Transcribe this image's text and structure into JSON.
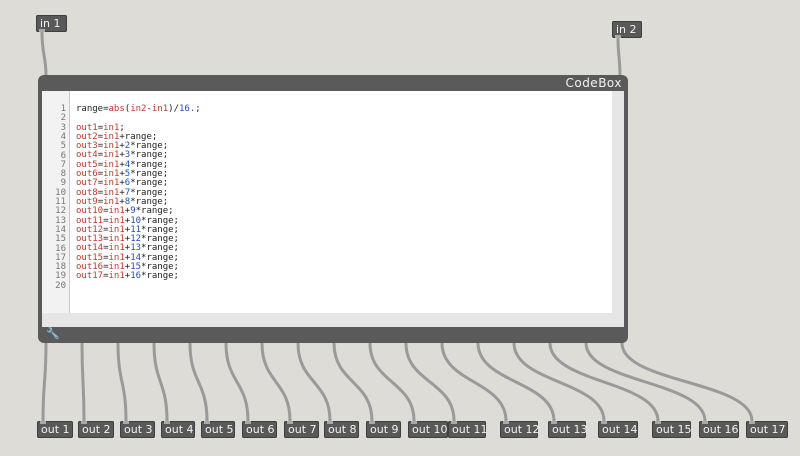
{
  "inlets": [
    {
      "id": "in1",
      "label": "in 1"
    },
    {
      "id": "in2",
      "label": "in 2"
    }
  ],
  "codebox": {
    "title": "CodeBox",
    "line_numbers": [
      "1",
      "2",
      "3",
      "4",
      "5",
      "6",
      "7",
      "8",
      "9",
      "10",
      "11",
      "12",
      "13",
      "14",
      "15",
      "16",
      "17",
      "18",
      "19",
      "20"
    ],
    "lines": [
      "range=abs(in2-in1)/16.;",
      "",
      "out1=in1;",
      "out2=in1+range;",
      "out3=in1+2*range;",
      "out4=in1+3*range;",
      "out5=in1+4*range;",
      "out6=in1+5*range;",
      "out7=in1+6*range;",
      "out8=in1+7*range;",
      "out9=in1+8*range;",
      "out10=in1+9*range;",
      "out11=in1+10*range;",
      "out12=in1+11*range;",
      "out13=in1+12*range;",
      "out14=in1+13*range;",
      "out15=in1+14*range;",
      "out16=in1+15*range;",
      "out17=in1+16*range;",
      ""
    ],
    "wrench_icon": "wrench-icon"
  },
  "outlets": [
    {
      "id": "out1",
      "label": "out 1"
    },
    {
      "id": "out2",
      "label": "out 2"
    },
    {
      "id": "out3",
      "label": "out 3"
    },
    {
      "id": "out4",
      "label": "out 4"
    },
    {
      "id": "out5",
      "label": "out 5"
    },
    {
      "id": "out6",
      "label": "out 6"
    },
    {
      "id": "out7",
      "label": "out 7"
    },
    {
      "id": "out8",
      "label": "out 8"
    },
    {
      "id": "out9",
      "label": "out 9"
    },
    {
      "id": "out10",
      "label": "out 10"
    },
    {
      "id": "out11",
      "label": "out 11"
    },
    {
      "id": "out12",
      "label": "out 12"
    },
    {
      "id": "out13",
      "label": "out 13"
    },
    {
      "id": "out14",
      "label": "out 14"
    },
    {
      "id": "out15",
      "label": "out 15"
    },
    {
      "id": "out16",
      "label": "out 16"
    },
    {
      "id": "out17",
      "label": "out 17"
    }
  ],
  "colors": {
    "background": "#dedcd6",
    "object": "#595959",
    "cord": "#9a9a9a",
    "keyword": "#c0392b",
    "number": "#1f4fbf"
  }
}
